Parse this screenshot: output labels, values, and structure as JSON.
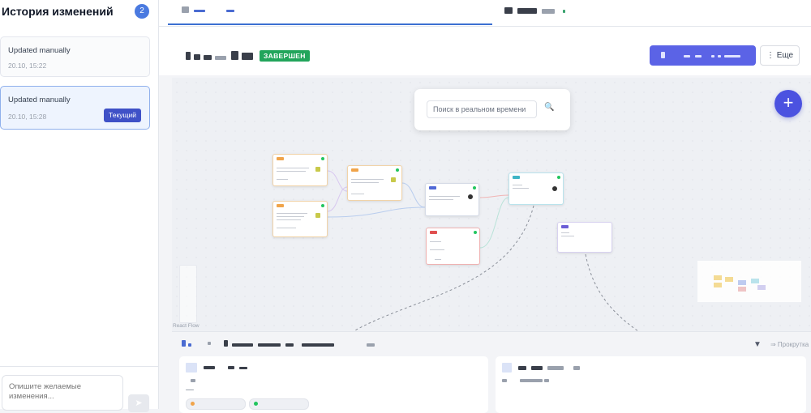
{
  "sidebar": {
    "title": "История изменений",
    "count": "2",
    "history": [
      {
        "title": "Updated manually",
        "date": "20.10, 15:22"
      },
      {
        "title": "Updated manually",
        "date": "20.10, 15:28",
        "badge": "Текущий"
      }
    ],
    "chat_placeholder": "Опишите желаемые изменения..."
  },
  "header": {
    "status": "ЗАВЕРШЕН",
    "more_label": "⋮ Еще"
  },
  "canvas": {
    "search_placeholder": "Поиск в реальном времени",
    "library_label": "React Flow"
  },
  "bottom": {
    "scroll_label": "⇒ Прокрутка"
  },
  "colors": {
    "accent": "#5b63e6",
    "status_green": "#22a55b",
    "badge": "#3f51c7",
    "count_badge": "#4a7ae0"
  },
  "icons": [
    "send-icon",
    "search-icon",
    "plus-icon",
    "filter-icon"
  ]
}
